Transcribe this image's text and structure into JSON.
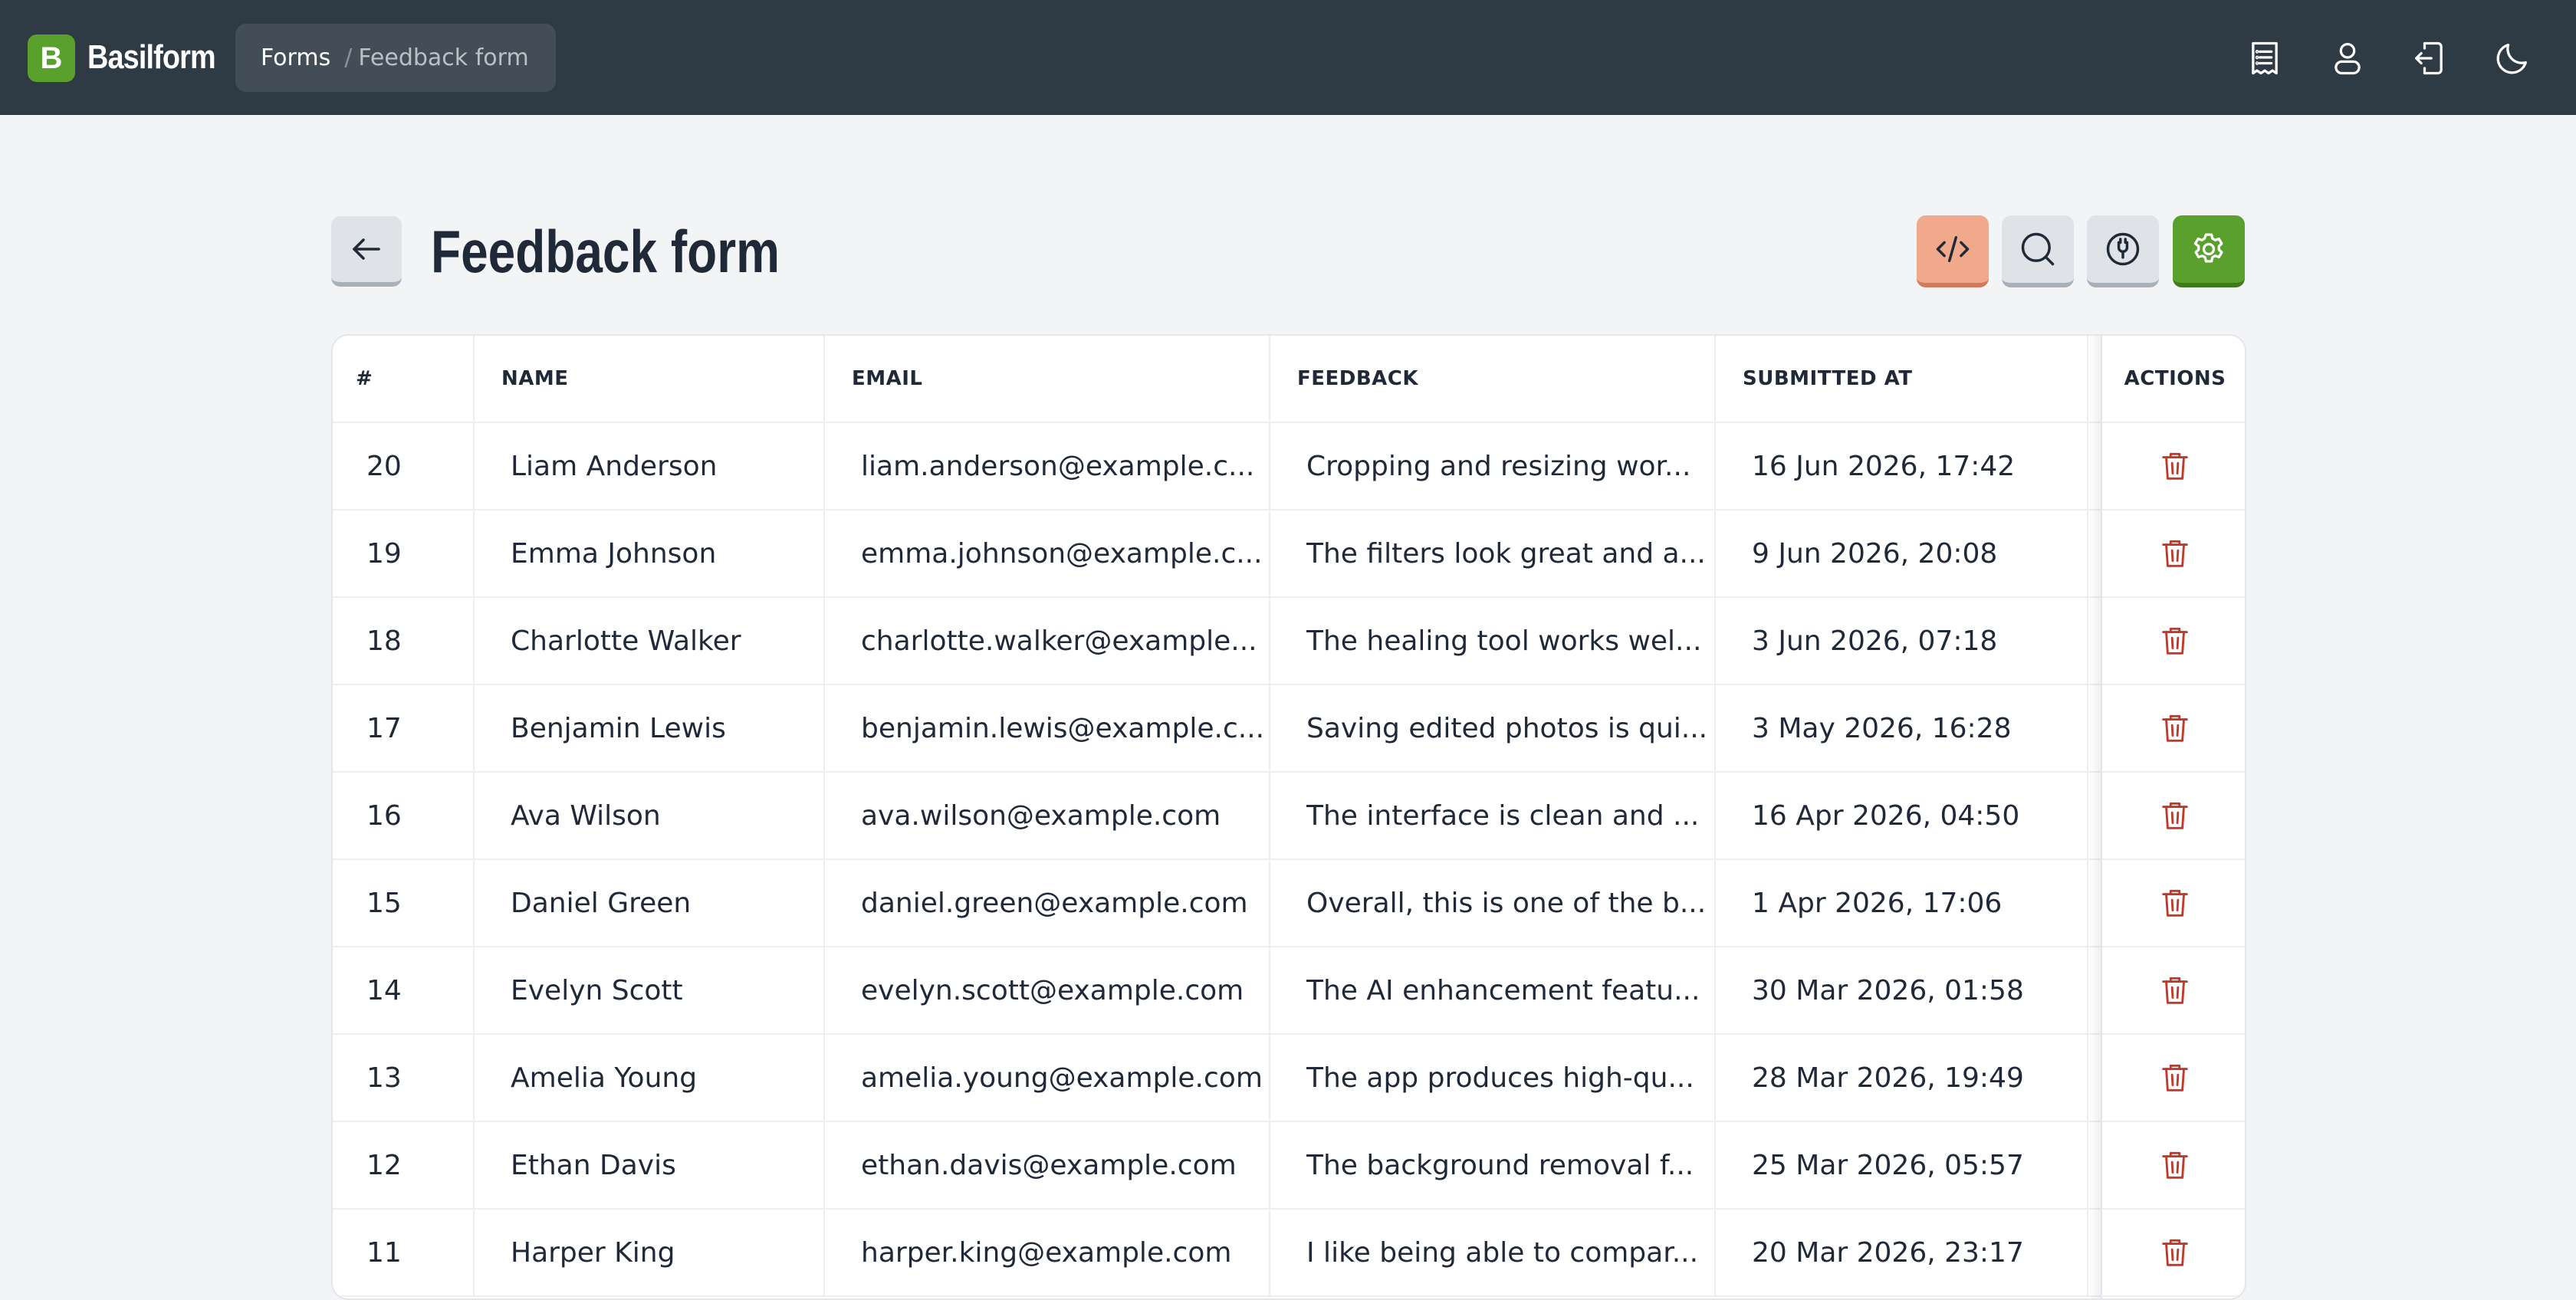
{
  "app": {
    "logo_letter": "B",
    "name": "Basilform"
  },
  "breadcrumb": {
    "root": "Forms",
    "separator": "/",
    "current": "Feedback form"
  },
  "topbar_icons": [
    "submissions-list-icon",
    "user-icon",
    "logout-icon",
    "dark-mode-moon-icon"
  ],
  "page": {
    "title": "Feedback form"
  },
  "toolbar": {
    "buttons": [
      "embed-code-icon",
      "search-icon",
      "webhook-icon",
      "settings-gear-icon"
    ]
  },
  "colors": {
    "topbar": "#2e3a44",
    "brand_green": "#5aa02c",
    "embed_orange": "#f0a98a",
    "delete_red": "#c0392b",
    "background": "#f3f4f6"
  },
  "table": {
    "columns": [
      "#",
      "NAME",
      "EMAIL",
      "FEEDBACK",
      "SUBMITTED AT",
      "ACTIONS"
    ],
    "rows": [
      {
        "id": "20",
        "name": "Liam Anderson",
        "email": "liam.anderson@example.c...",
        "feedback": "Cropping and resizing wor...",
        "submitted": "16 Jun 2026, 17:42"
      },
      {
        "id": "19",
        "name": "Emma Johnson",
        "email": "emma.johnson@example.c...",
        "feedback": "The filters look great and a...",
        "submitted": "9 Jun 2026, 20:08"
      },
      {
        "id": "18",
        "name": "Charlotte Walker",
        "email": "charlotte.walker@example...",
        "feedback": "The healing tool works wel...",
        "submitted": "3 Jun 2026, 07:18"
      },
      {
        "id": "17",
        "name": "Benjamin Lewis",
        "email": "benjamin.lewis@example.c...",
        "feedback": "Saving edited photos is qui...",
        "submitted": "3 May 2026, 16:28"
      },
      {
        "id": "16",
        "name": "Ava Wilson",
        "email": "ava.wilson@example.com",
        "feedback": "The interface is clean and ...",
        "submitted": "16 Apr 2026, 04:50"
      },
      {
        "id": "15",
        "name": "Daniel Green",
        "email": "daniel.green@example.com",
        "feedback": "Overall, this is one of the b...",
        "submitted": "1 Apr 2026, 17:06"
      },
      {
        "id": "14",
        "name": "Evelyn Scott",
        "email": "evelyn.scott@example.com",
        "feedback": "The AI enhancement featu...",
        "submitted": "30 Mar 2026, 01:58"
      },
      {
        "id": "13",
        "name": "Amelia Young",
        "email": "amelia.young@example.com",
        "feedback": "The app produces high-qu...",
        "submitted": "28 Mar 2026, 19:49"
      },
      {
        "id": "12",
        "name": "Ethan Davis",
        "email": "ethan.davis@example.com",
        "feedback": "The background removal f...",
        "submitted": "25 Mar 2026, 05:57"
      },
      {
        "id": "11",
        "name": "Harper King",
        "email": "harper.king@example.com",
        "feedback": "I like being able to compar...",
        "submitted": "20 Mar 2026, 23:17"
      }
    ],
    "row_action_icon": "trash-icon"
  }
}
